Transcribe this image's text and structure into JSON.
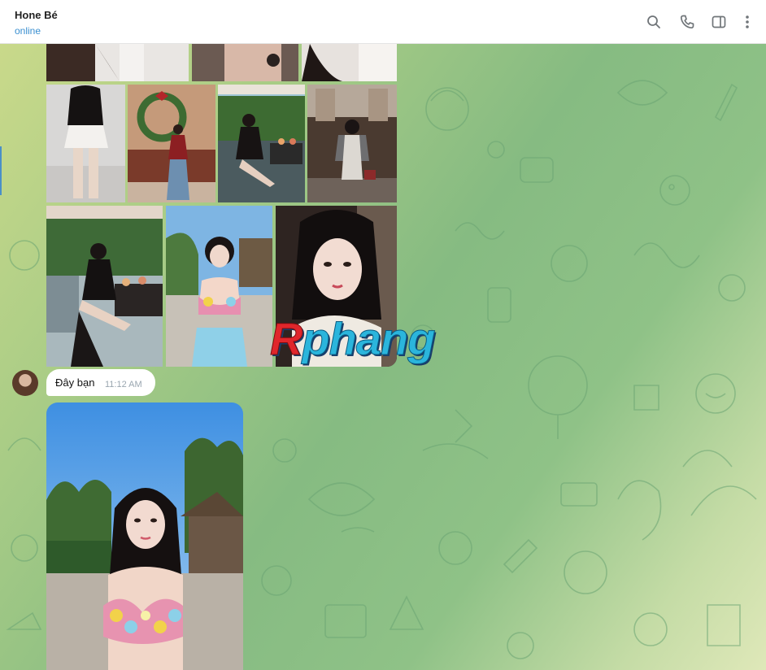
{
  "header": {
    "contact_name": "Hone Bé",
    "status": "online",
    "icons": [
      "search-icon",
      "phone-icon",
      "sidebar-toggle-icon",
      "more-vertical-icon"
    ]
  },
  "messages": [
    {
      "type": "album",
      "photo_count": 10
    },
    {
      "type": "text",
      "text": "Đây bạn",
      "time": "11:12 AM"
    },
    {
      "type": "photo"
    }
  ],
  "watermark": {
    "first": "R",
    "rest": "phang"
  },
  "colors": {
    "accent": "#3a8fd0",
    "chat_bg_light": "#dfe8b9",
    "chat_bg_green": "#86bb82",
    "pattern_stroke": "#6aa473"
  }
}
